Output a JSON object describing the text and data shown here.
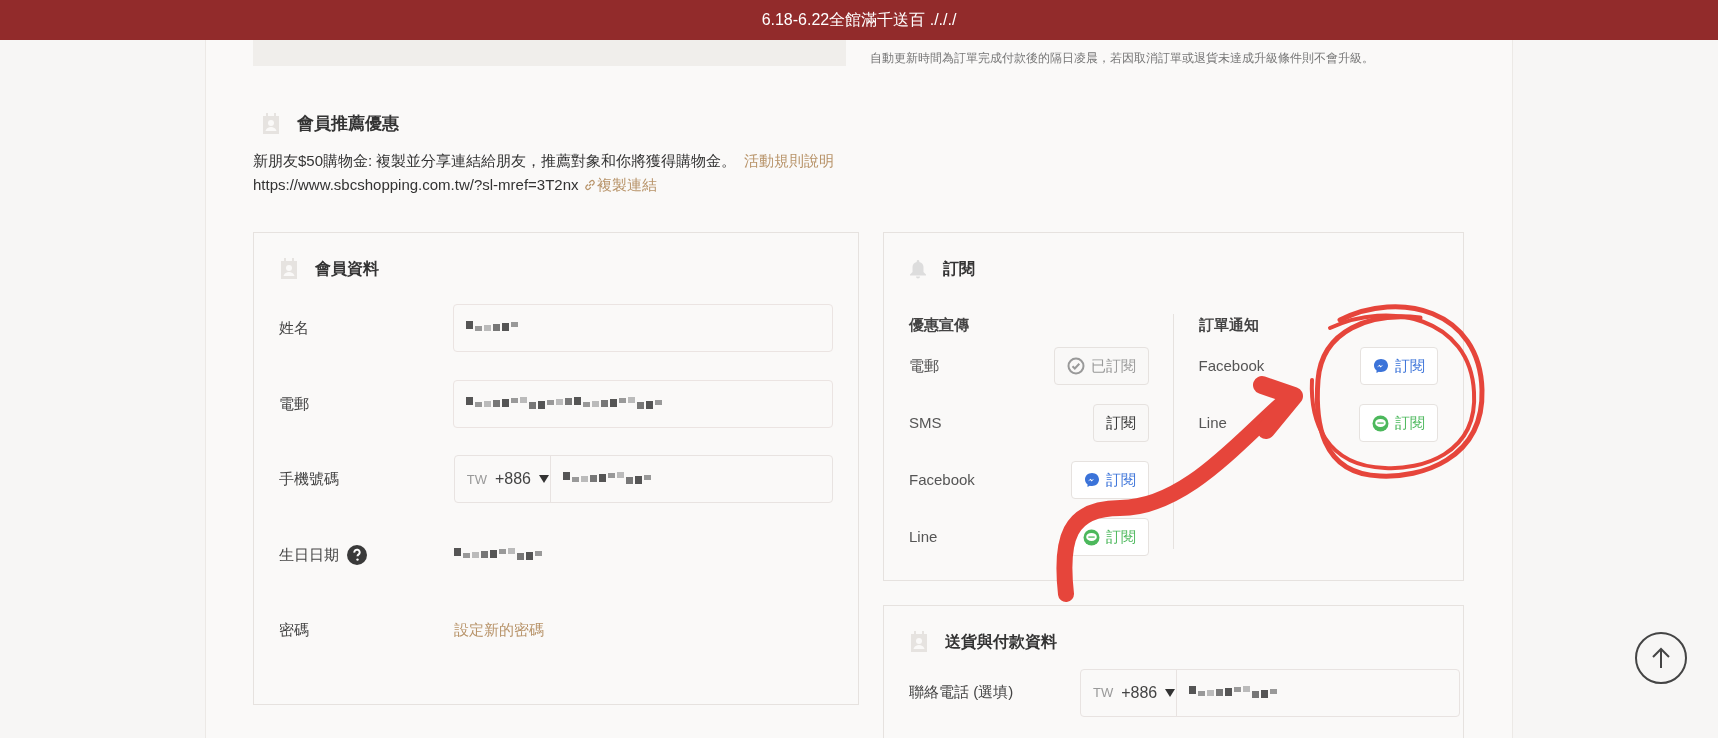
{
  "banner": {
    "text": "6.18-6.22全館滿千送百 ./././"
  },
  "level_note": "自動更新時間為訂單完成付款後的隔日凌晨，若因取消訂單或退貨未達成升級條件則不會升級。",
  "referral": {
    "title": "會員推薦優惠",
    "description": "新朋友$50購物金: 複製並分享連結給朋友，推薦對象和你將獲得購物金。",
    "rules_link": "活動規則說明",
    "url": "https://www.sbcshopping.com.tw/?sl-mref=3T2nx",
    "copy_link": "複製連結"
  },
  "member_info": {
    "title": "會員資料",
    "rows": [
      {
        "label": "姓名",
        "kind": "input",
        "obscured": true
      },
      {
        "label": "電郵",
        "kind": "input",
        "obscured": true
      },
      {
        "label": "手機號碼",
        "kind": "phone",
        "country": "TW",
        "code": "+886",
        "obscured": true
      },
      {
        "label": "生日日期",
        "kind": "text",
        "help": true,
        "obscured": true
      },
      {
        "label": "密碼",
        "kind": "link",
        "link": "設定新的密碼"
      }
    ]
  },
  "subscription": {
    "title": "訂閱",
    "columns": [
      {
        "heading": "優惠宣傳",
        "rows": [
          {
            "label": "電郵",
            "kind": "plain",
            "subscribed": true,
            "button": "已訂閱"
          },
          {
            "label": "SMS",
            "kind": "plain",
            "subscribed": false,
            "button": "訂閱"
          },
          {
            "label": "Facebook",
            "kind": "messenger",
            "subscribed": false,
            "button": "訂閱"
          },
          {
            "label": "Line",
            "kind": "line",
            "subscribed": false,
            "button": "訂閱"
          }
        ]
      },
      {
        "heading": "訂單通知",
        "rows": [
          {
            "label": "Facebook",
            "kind": "messenger",
            "subscribed": false,
            "button": "訂閱"
          },
          {
            "label": "Line",
            "kind": "line",
            "subscribed": false,
            "button": "訂閱"
          }
        ]
      }
    ]
  },
  "delivery": {
    "title": "送貨與付款資料",
    "rows": [
      {
        "label": "聯絡電話 (選填)",
        "country": "TW",
        "code": "+886",
        "obscured": true
      }
    ]
  }
}
